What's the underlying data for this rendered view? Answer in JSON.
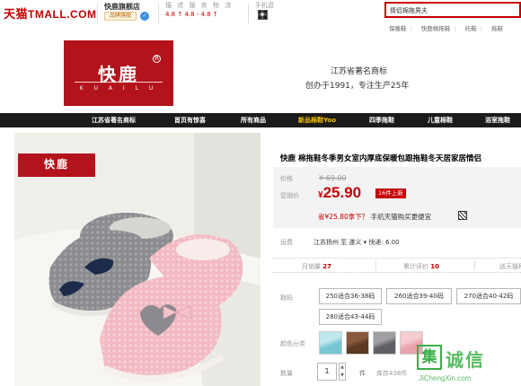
{
  "header": {
    "logo_cn": "天猫",
    "logo_en": "TMALL.COM",
    "shop_name": "快鹿旗舰店",
    "shop_badge": "品牌旗舰",
    "ratings_head": "描 述  服 务  物 流",
    "ratings_values": "4.8 ↑  4.8 -  4.8 ↑",
    "mobile_label": "手机逛",
    "search_value": "情侣棉拖男夫",
    "hot_words": [
      "保暖鞋",
      "快鹿棉拖鞋",
      "托鞋",
      "拖鞋"
    ]
  },
  "banner": {
    "brand_cn": "快鹿",
    "brand_en": "K U A I L U",
    "slogan_line1": "江苏省著名商标",
    "slogan_line2": "创办于1991，专注生产25年"
  },
  "nav": {
    "items": [
      "江苏省著名商标",
      "首页有惊喜",
      "所有商品",
      "新品棉鞋Yoo",
      "四季拖鞋",
      "儿童棉鞋",
      "浴室拖鞋"
    ]
  },
  "photo": {
    "logo": "快鹿"
  },
  "product": {
    "title": "快鹿 棉拖鞋冬季男女室内厚底保暖包跟拖鞋冬天居家居情侣",
    "price_label": "价格",
    "old_price": "¥ 69.00",
    "promo_label": "促销价",
    "currency": "¥",
    "price": "25.90",
    "price_tag": "16件上新",
    "promo_text": "省¥25.80拿下？",
    "promo_phone": "手机天猫购买更便宜",
    "ship_label": "运费",
    "ship_value": "江苏扬州 至 遂义 ▾  快递: 6.00",
    "monthly_sales_label": "月销量",
    "monthly_sales": "27",
    "reviews_label": "累计评价",
    "reviews": "10",
    "points_label": "送天猫积",
    "size_label": "鞋码",
    "sizes": [
      "250适合36-38码",
      "260适合39-40码",
      "270适合40-42码",
      "280适合43-44码"
    ],
    "color_label": "颜色分类",
    "qty_label": "数量",
    "qty": "1",
    "qty_unit": "件",
    "stock": "库存438件"
  },
  "watermark": {
    "char": "集",
    "text": "诚信",
    "url": "JiChengXin.com"
  },
  "colors": {
    "tmall_red": "#c40000",
    "brand_red": "#b3141c",
    "nav_bg": "#1b1b1b",
    "nav_highlight": "#f5c200",
    "watermark_green": "#3cae48"
  }
}
